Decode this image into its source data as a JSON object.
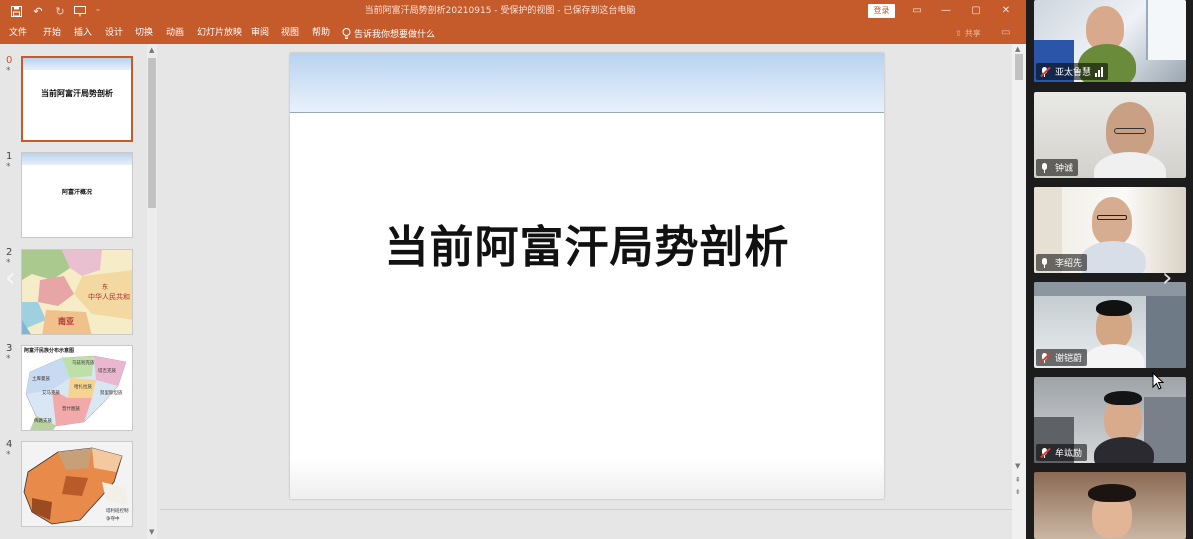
{
  "window": {
    "title": "当前阿富汗局势剖析20210915 - 受保护的视图 - 已保存到这台电脑",
    "login_label": "登录"
  },
  "ribbon": {
    "tabs": [
      "文件",
      "开始",
      "插入",
      "设计",
      "切换",
      "动画",
      "幻灯片放映",
      "审阅",
      "视图",
      "帮助"
    ],
    "tell_me": "告诉我你想要做什么",
    "share_label": "共享"
  },
  "thumbnails": [
    {
      "number": "0",
      "title": "当前阿富汗局势剖析",
      "selected": true
    },
    {
      "number": "1",
      "title": "阿富汗概况",
      "selected": false
    },
    {
      "number": "2",
      "title": "",
      "map_labels": [
        "中华人民共和",
        "南亚",
        "东"
      ],
      "selected": false
    },
    {
      "number": "3",
      "title": "阿富汗民族分布示意图",
      "map_labels": [
        "乌兹别克族",
        "塔吉克族",
        "哈扎拉族",
        "普什图族",
        "俾路支族",
        "土库曼族",
        "艾马克族",
        "努里斯坦族"
      ],
      "selected": false
    },
    {
      "number": "4",
      "title": "",
      "map_labels": [
        "塔利班控制",
        "争夺中"
      ],
      "selected": false
    }
  ],
  "slide": {
    "title": "当前阿富汗局势剖析"
  },
  "participants": [
    {
      "name": "亚太鲁慧",
      "muted": true,
      "speaking": true
    },
    {
      "name": "钟诚",
      "muted": false,
      "speaking": false
    },
    {
      "name": "李绍先",
      "muted": false,
      "speaking": false
    },
    {
      "name": "谢铠蔚",
      "muted": true,
      "speaking": false
    },
    {
      "name": "牟竑励",
      "muted": true,
      "speaking": false
    },
    {
      "name": "",
      "muted": false,
      "speaking": false
    }
  ],
  "colors": {
    "accent": "#c55a2b",
    "muted_mic": "#e03c31"
  },
  "icons": [
    "save-icon",
    "undo-icon",
    "redo-icon",
    "present-icon",
    "lightbulb-icon",
    "share-icon",
    "comment-icon",
    "mic-icon",
    "mic-muted-icon",
    "audio-level-icon",
    "chevron-right-icon",
    "chevron-left-icon"
  ]
}
